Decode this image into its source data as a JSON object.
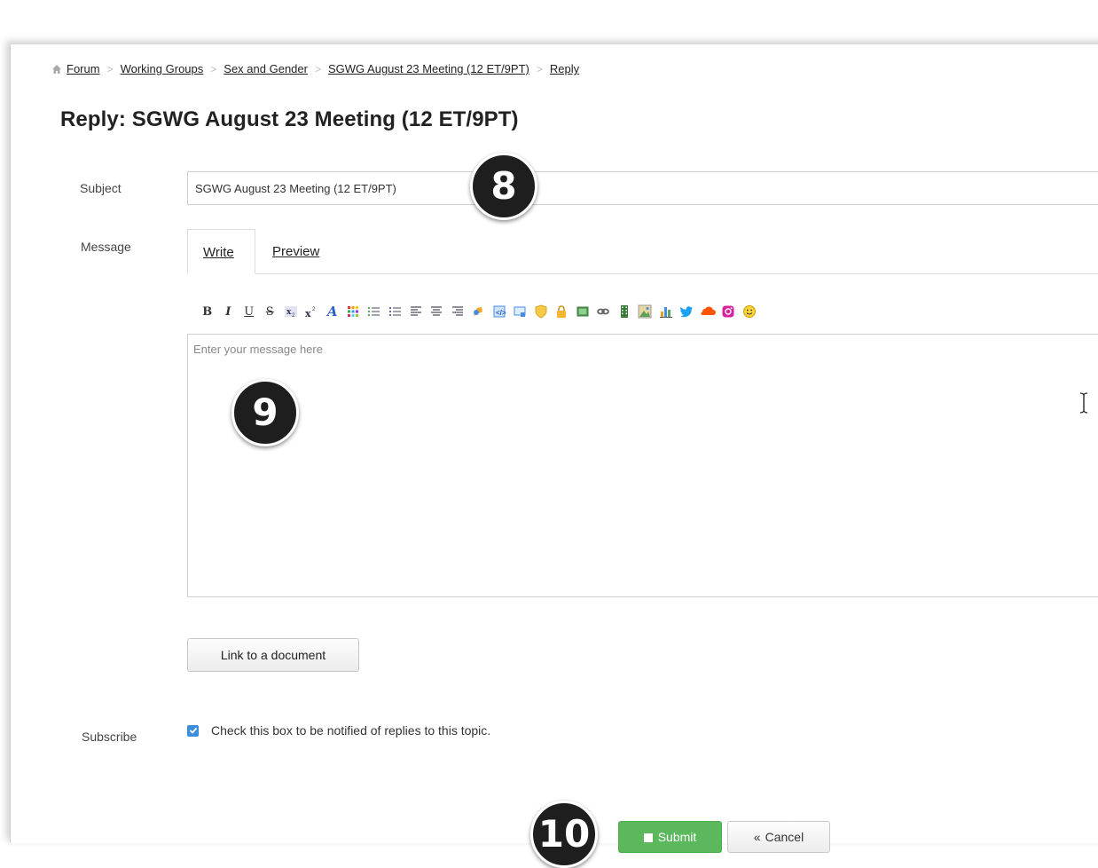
{
  "breadcrumb": {
    "items": [
      "Forum",
      "Working Groups",
      "Sex and Gender",
      "SGWG August 23 Meeting (12 ET/9PT)",
      "Reply"
    ]
  },
  "page_title": "Reply: SGWG August 23 Meeting (12 ET/9PT)",
  "form": {
    "subject_label": "Subject",
    "subject_value": "SGWG August 23 Meeting (12 ET/9PT)",
    "message_label": "Message",
    "tabs": [
      {
        "label": "Write",
        "active": true
      },
      {
        "label": "Preview",
        "active": false
      }
    ],
    "toolbar_icons": [
      "bold-icon",
      "italic-icon",
      "underline-icon",
      "strikethrough-icon",
      "subscript-icon",
      "superscript-icon",
      "font-color-icon",
      "color-grid-icon",
      "bullet-list-icon",
      "numbered-list-icon",
      "align-left-icon",
      "align-center-icon",
      "align-right-icon",
      "quote-icon",
      "code-icon",
      "spoiler-icon",
      "hide-icon",
      "lock-icon",
      "image-icon",
      "link-icon",
      "video-icon",
      "album-icon",
      "chart-icon",
      "twitter-icon",
      "soundcloud-icon",
      "instagram-icon",
      "smiley-icon"
    ],
    "message_placeholder": "Enter your message here",
    "link_document_label": "Link to a document",
    "subscribe_label": "Subscribe",
    "subscribe_text": "Check this box to be notified of replies to this topic.",
    "subscribe_checked": true,
    "submit_label": "Submit",
    "cancel_label": "Cancel"
  },
  "annotations": [
    "8",
    "9",
    "10"
  ],
  "colors": {
    "submit_green": "#5cb85c",
    "checkbox_blue": "#3c8dde",
    "badge_dark": "#1e1e1e"
  }
}
